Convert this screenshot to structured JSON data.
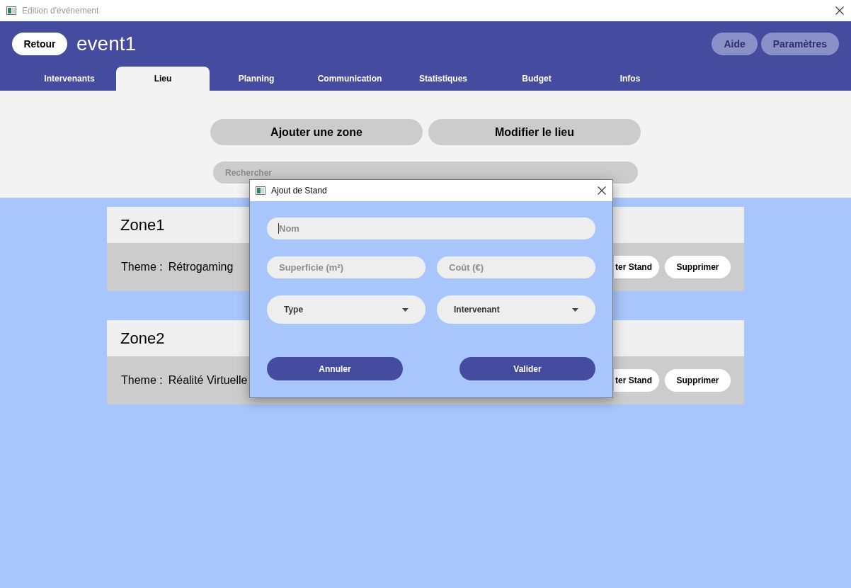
{
  "window": {
    "title": "Edition d'événement"
  },
  "header": {
    "back_button": "Retour",
    "event_name": "event1",
    "buttons": [
      "Aide",
      "Paramètres"
    ]
  },
  "tabs": [
    {
      "label": "Intervenants",
      "selected": false
    },
    {
      "label": "Lieu",
      "selected": true
    },
    {
      "label": "Planning",
      "selected": false
    },
    {
      "label": "Communication",
      "selected": false
    },
    {
      "label": "Statistiques",
      "selected": false
    },
    {
      "label": "Budget",
      "selected": false
    },
    {
      "label": "Infos",
      "selected": false
    }
  ],
  "actions": [
    "Ajouter une zone",
    "Modifier le lieu"
  ],
  "search": {
    "placeholder": "Rechercher"
  },
  "zones": [
    {
      "name": "Zone1",
      "theme_label": "Theme :",
      "theme": "Rétrogaming",
      "buttons": [
        {
          "label": "ter Stand",
          "kind": "clipped"
        },
        {
          "label": "Supprimer",
          "kind": "full"
        }
      ]
    },
    {
      "name": "Zone2",
      "theme_label": "Theme :",
      "theme": "Réalité Virtuelle",
      "buttons": [
        {
          "label": "ter Stand",
          "kind": "clipped"
        },
        {
          "label": "Supprimer",
          "kind": "full"
        }
      ]
    }
  ],
  "dialog": {
    "title": "Ajout de Stand",
    "rows": [
      [
        {
          "kind": "text",
          "placeholder": "Nom",
          "focused": true
        }
      ],
      [
        {
          "kind": "text",
          "placeholder": "Superficie (m²)",
          "focused": false
        },
        {
          "kind": "text",
          "placeholder": "Coût (€)",
          "focused": false
        }
      ],
      [
        {
          "kind": "select",
          "label": "Type"
        },
        {
          "kind": "select",
          "label": "Intervenant"
        }
      ]
    ],
    "buttons": [
      "Annuler",
      "Valider"
    ]
  }
}
